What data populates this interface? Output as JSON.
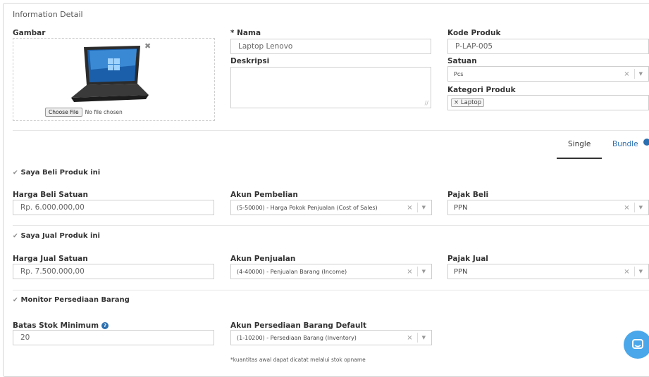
{
  "section": {
    "title": "Information Detail"
  },
  "gambar": {
    "label": "Gambar",
    "choose_file": "Choose File",
    "no_file": "No file chosen",
    "remove_icon": "close-icon"
  },
  "nama": {
    "label": "* Nama",
    "value": "Laptop Lenovo"
  },
  "deskripsi": {
    "label": "Deskripsi",
    "value": ""
  },
  "kode_produk": {
    "label": "Kode Produk",
    "value": "P-LAP-005"
  },
  "satuan": {
    "label": "Satuan",
    "value": "Pcs"
  },
  "kategori": {
    "label": "Kategori Produk",
    "tag": "Laptop"
  },
  "tabs": {
    "single": "Single",
    "bundle": "Bundle",
    "active": "Single"
  },
  "beli": {
    "checkbox": "Saya Beli Produk ini",
    "harga_label": "Harga Beli Satuan",
    "harga_value": "Rp. 6.000.000,00",
    "akun_label": "Akun Pembelian",
    "akun_value": "(5-50000) - Harga Pokok Penjualan (Cost of Sales)",
    "pajak_label": "Pajak Beli",
    "pajak_value": "PPN"
  },
  "jual": {
    "checkbox": "Saya Jual Produk ini",
    "harga_label": "Harga Jual Satuan",
    "harga_value": "Rp. 7.500.000,00",
    "akun_label": "Akun Penjualan",
    "akun_value": "(4-40000) - Penjualan Barang (Income)",
    "pajak_label": "Pajak Jual",
    "pajak_value": "PPN"
  },
  "persediaan": {
    "checkbox": "Monitor Persediaan Barang",
    "batas_label": "Batas Stok Minimum",
    "batas_value": "20",
    "akun_label": "Akun Persediaan Barang Default",
    "akun_value": "(1-10200) - Persediaan Barang (Inventory)",
    "note": "*kuantitas awal dapat dicatat melalui stok opname"
  },
  "colors": {
    "accent": "#2a6fb0",
    "chat": "#49a7ea"
  }
}
